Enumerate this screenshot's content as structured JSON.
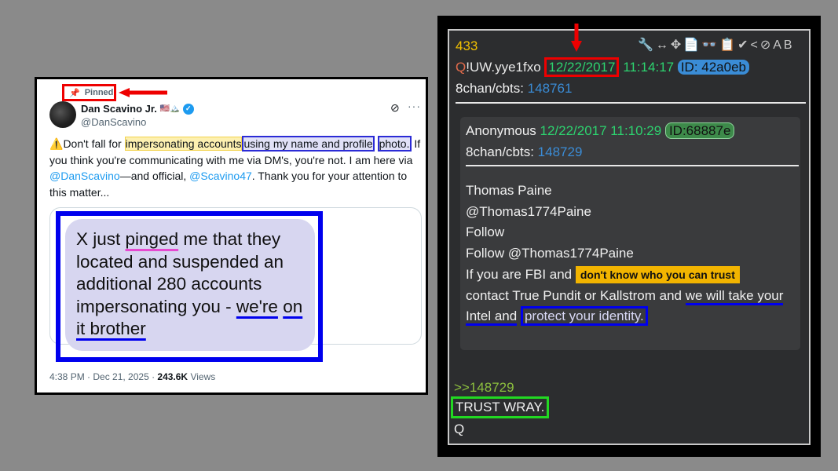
{
  "tweet": {
    "pinned_label": "Pinned",
    "author_name": "Dan Scavino Jr.",
    "author_flags": "🇺🇸🏔️",
    "author_handle": "@DanScavino",
    "text_warning": "⚠️",
    "text_part1": "Don't fall for ",
    "text_hl_yellow": "impersonating accounts",
    "text_box1": "using my name and profile",
    "text_box2": "photo.",
    "text_part2": " If you think you're communicating with me via DM's, you're not. I am here via ",
    "mention1": "@DanScavino",
    "text_part3": "—and official, ",
    "mention2": "@Scavino47",
    "text_part4": ". Thank you for your attention to this matter...",
    "quote": {
      "w1": "X just ",
      "pinged": "pinged",
      "w2": " me that they located and suspended an additional 280 accounts impersonating you - ",
      "we_re": "we're",
      "w3": " ",
      "on_it_brother": "on it brother"
    },
    "time": "4:38 PM · Dec 21, 2025 · ",
    "views_count": "243.6K",
    "views_label": " Views"
  },
  "qpost": {
    "number": "433",
    "icons": "🔧↔✥📄👓📋✔<⊘AB",
    "trip_q": "Q",
    "trip_id": "!UW.yye1fxo ",
    "date": "12/22/2017",
    "time": " 11:14:17 ",
    "id_badge": "ID: 42a0eb",
    "board": "8chan/cbts: ",
    "board_link": "148761",
    "inner": {
      "name": "Anonymous ",
      "datetime": "12/22/2017 11:10:29 ",
      "id_badge": "ID:68887e",
      "board": "8chan/cbts: ",
      "board_link": "148729",
      "line1": "Thomas Paine",
      "line2": "@Thomas1774Paine",
      "line3": "Follow",
      "line4": "Follow @Thomas1774Paine",
      "line5a": " If you are FBI and ",
      "line5_hl": "don't know who you can trust",
      "line6a": "contact True Pundit or Kallstrom and ",
      "line6_u": "we will take your",
      "line7_u": "Intel and",
      "line7_box": "protect your identity."
    },
    "reply_link": ">>148729",
    "trust_text": "TRUST WRAY.",
    "signature": "Q"
  }
}
